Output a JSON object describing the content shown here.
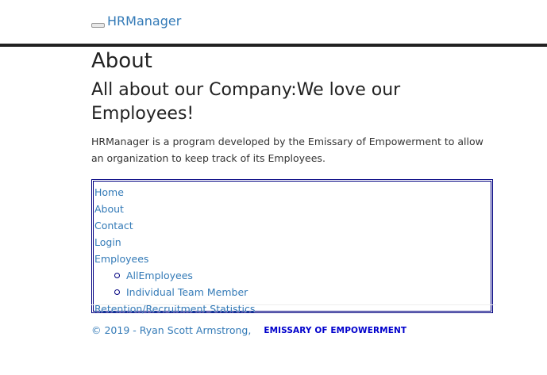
{
  "navbar": {
    "brand": "HRManager"
  },
  "main": {
    "title": "About",
    "subtitle": "All about our Company:We love our Employees!",
    "description": "HRManager is a program developed by the Emissary of Empowerment to allow an organization to keep track of its Employees."
  },
  "nav": {
    "items": [
      "Home",
      "About",
      "Contact",
      "Login",
      "Employees"
    ],
    "employees_sub": [
      "AllEmployees",
      "Individual Team Member"
    ],
    "last": "Retention/Recruitment Statistics"
  },
  "footer": {
    "copyright": "© 2019 - Ryan Scott Armstrong,",
    "company": "EMISSARY OF EMPOWERMENT"
  },
  "colors": {
    "link": "#337ab7",
    "border": "#000080",
    "company": "#0000cc"
  }
}
